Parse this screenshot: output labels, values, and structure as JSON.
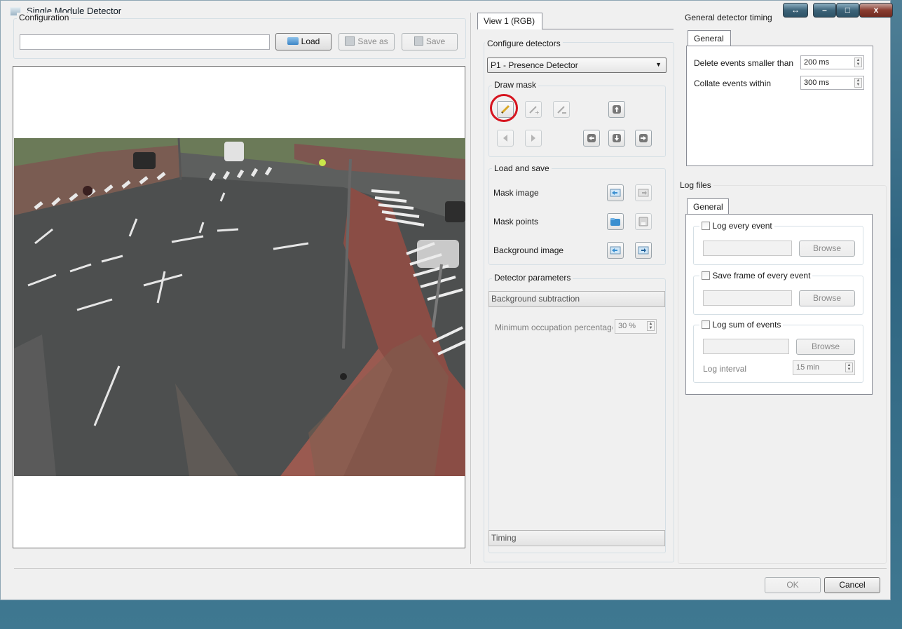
{
  "window": {
    "title": "Single Module Detector",
    "controls": [
      "resize-icon",
      "minimize-icon",
      "maximize-icon",
      "close-icon"
    ]
  },
  "configuration": {
    "group_label": "Configuration",
    "path_value": "",
    "load_label": "Load",
    "save_as_label": "Save as",
    "save_label": "Save"
  },
  "view_tab": {
    "label": "View 1 (RGB)"
  },
  "configure_detectors": {
    "group_label": "Configure detectors",
    "selected_detector": "P1 - Presence Detector",
    "draw_mask": {
      "label": "Draw mask",
      "tools": [
        "pencil-icon",
        "pencil-add-icon",
        "pencil-remove-icon",
        "arrow-up-icon",
        "triangle-left-icon",
        "triangle-right-icon",
        "arrow-left-icon",
        "arrow-down-icon",
        "arrow-right-icon"
      ]
    },
    "load_and_save": {
      "label": "Load and save",
      "rows": [
        {
          "label": "Mask image"
        },
        {
          "label": "Mask points"
        },
        {
          "label": "Background image"
        }
      ]
    },
    "detector_parameters": {
      "label": "Detector parameters",
      "background_subtraction": "Background subtraction",
      "min_occupation_label": "Minimum occupation percentage",
      "min_occupation_value": "30 %",
      "timing": "Timing"
    }
  },
  "general_detector_timing": {
    "group_label": "General detector timing",
    "tab_label": "General",
    "delete_label": "Delete events smaller than",
    "delete_value": "200 ms",
    "collate_label": "Collate events within",
    "collate_value": "300 ms"
  },
  "log_files": {
    "group_label": "Log files",
    "tab_label": "General",
    "log_every_event": "Log every event",
    "save_frame": "Save frame of every event",
    "log_sum": "Log sum of events",
    "browse_label": "Browse",
    "log_interval_label": "Log interval",
    "log_interval_value": "15 min"
  },
  "footer": {
    "ok_label": "OK",
    "cancel_label": "Cancel"
  },
  "colors": {
    "highlight_circle": "#d6141f",
    "accent": "#3a8fd0"
  }
}
